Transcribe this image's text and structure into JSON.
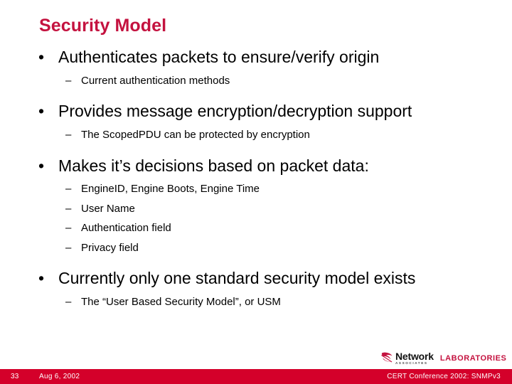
{
  "slide": {
    "title": "Security Model",
    "title_color": "#c4123f",
    "background": "#ffffff",
    "bullet_marker_level1": "•",
    "bullet_marker_level2": "–",
    "outline": [
      {
        "level": 1,
        "text": "Authenticates packets to ensure/verify origin"
      },
      {
        "level": 2,
        "text": "Current authentication methods"
      },
      {
        "level": 1,
        "text": "Provides message encryption/decryption support"
      },
      {
        "level": 2,
        "text": "The ScopedPDU can be protected by encryption"
      },
      {
        "level": 1,
        "text": "Makes it’s decisions based on packet data:"
      },
      {
        "level": 2,
        "text": "EngineID, Engine Boots, Engine Time"
      },
      {
        "level": 2,
        "text": "User Name"
      },
      {
        "level": 2,
        "text": "Authentication field"
      },
      {
        "level": 2,
        "text": "Privacy field"
      },
      {
        "level": 1,
        "text": "Currently only one standard security model exists"
      },
      {
        "level": 2,
        "text": "The “User Based Security Model”, or USM"
      }
    ]
  },
  "logo": {
    "name": "Network",
    "sub": "ASSOCIATES",
    "labs": "LABORATORIES",
    "mark_color": "#c4123f",
    "labs_color": "#c4123f"
  },
  "footer": {
    "page_number": "33",
    "date": "Aug 6, 2002",
    "conference": "CERT Conference 2002: SNMPv3",
    "bar_color": "#d4002a",
    "text_color": "#ffffff"
  }
}
